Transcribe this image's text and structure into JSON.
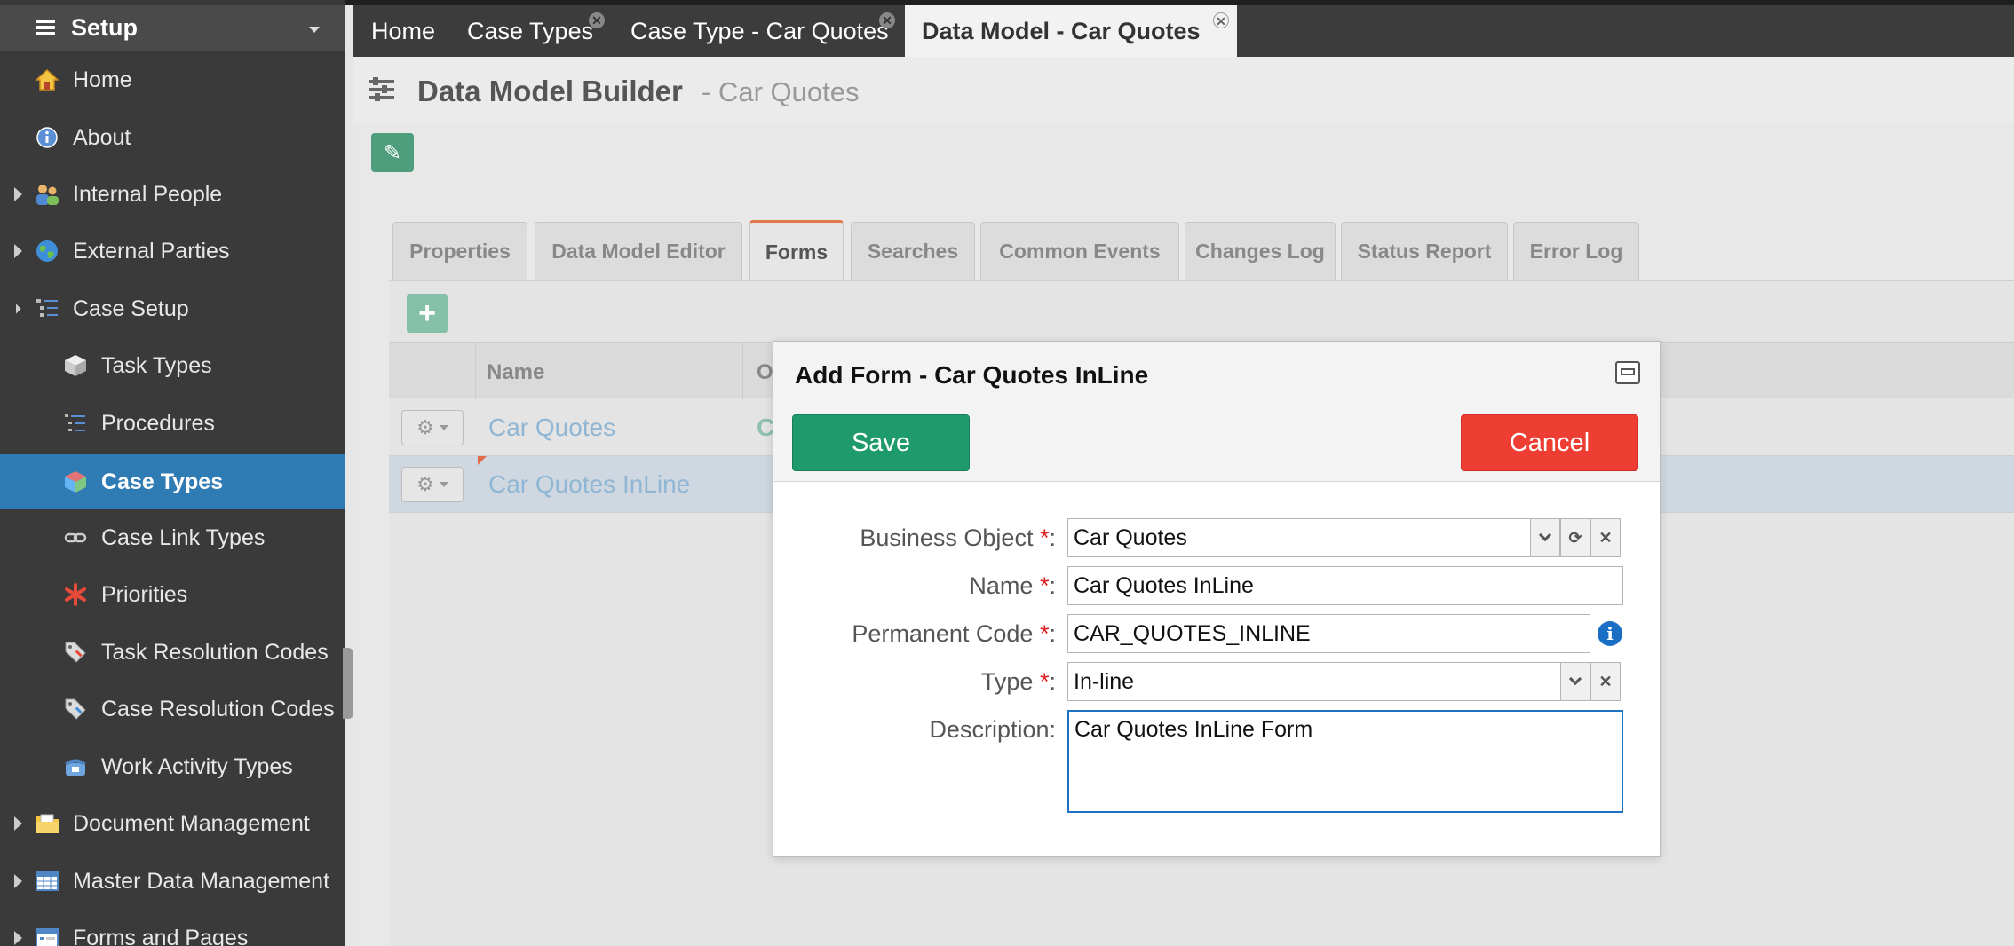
{
  "sidebar": {
    "title": "Setup",
    "items": [
      {
        "label": "Home",
        "icon": "house-icon"
      },
      {
        "label": "About",
        "icon": "info-icon"
      },
      {
        "label": "Internal People",
        "icon": "people-icon"
      },
      {
        "label": "External Parties",
        "icon": "globe-icon"
      },
      {
        "label": "Case Setup",
        "icon": "tree-icon"
      },
      {
        "label": "Task Types",
        "icon": "boxes-icon"
      },
      {
        "label": "Procedures",
        "icon": "procedure-tree-icon"
      },
      {
        "label": "Case Types",
        "icon": "cube-icon"
      },
      {
        "label": "Case Link Types",
        "icon": "link-icon"
      },
      {
        "label": "Priorities",
        "icon": "asterisk-icon"
      },
      {
        "label": "Task Resolution Codes",
        "icon": "tag-icon"
      },
      {
        "label": "Case Resolution Codes",
        "icon": "tag-icon"
      },
      {
        "label": "Work Activity Types",
        "icon": "phone-icon"
      },
      {
        "label": "Document Management",
        "icon": "folder-icon"
      },
      {
        "label": "Master Data Management",
        "icon": "table-icon"
      },
      {
        "label": "Forms and Pages",
        "icon": "form-icon"
      }
    ]
  },
  "tabs": [
    {
      "label": "Home"
    },
    {
      "label": "Case Types"
    },
    {
      "label": "Case Type - Car Quotes"
    },
    {
      "label": "Data Model - Car Quotes"
    }
  ],
  "builder": {
    "title": "Data Model Builder",
    "subtitle": "- Car Quotes"
  },
  "subtabs": [
    "Properties",
    "Data Model Editor",
    "Forms",
    "Searches",
    "Common Events",
    "Changes Log",
    "Status Report",
    "Error Log"
  ],
  "grid": {
    "columns": {
      "name": "Name",
      "second": "O"
    },
    "rows": [
      {
        "name": "Car Quotes",
        "second": "C"
      },
      {
        "name": "Car Quotes InLine",
        "second": ""
      }
    ]
  },
  "dialog": {
    "title": "Add Form - Car Quotes InLine",
    "save": "Save",
    "cancel": "Cancel",
    "fields": {
      "business_object": {
        "label": "Business Object",
        "value": "Car Quotes"
      },
      "name": {
        "label": "Name",
        "value": "Car Quotes InLine"
      },
      "permanent_code": {
        "label": "Permanent Code",
        "value": "CAR_QUOTES_INLINE"
      },
      "type": {
        "label": "Type",
        "value": "In-line"
      },
      "description": {
        "label": "Description:",
        "value": "Car Quotes InLine Form"
      }
    },
    "required_marker": "*",
    "colon": ":"
  },
  "colors": {
    "accent": "#2f7bb4",
    "save": "#1f9a6c",
    "cancel": "#ee3d33",
    "active_tab_border": "#e07a4a"
  }
}
